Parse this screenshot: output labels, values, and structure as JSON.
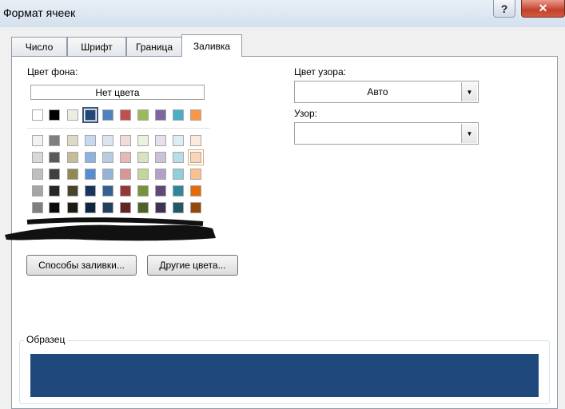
{
  "window": {
    "title": "Формат ячеек"
  },
  "titlebar": {
    "help_label": "?",
    "close_label": "✕"
  },
  "tabs": [
    {
      "label": "Число"
    },
    {
      "label": "Шрифт"
    },
    {
      "label": "Граница"
    },
    {
      "label": "Заливка"
    }
  ],
  "fill": {
    "bg_color_label": "Цвет фона:",
    "no_color_label": "Нет цвета",
    "selected_color": "#1f497d",
    "theme_row": [
      "#ffffff",
      "#000000",
      "#eeece1",
      "#1f497d",
      "#4f81bd",
      "#c0504d",
      "#9bbb59",
      "#8064a2",
      "#4bacc6",
      "#f79646"
    ],
    "shade_rows": [
      [
        "#f2f2f2",
        "#7f7f7f",
        "#ddd9c3",
        "#c6d9f0",
        "#dbe5f1",
        "#f2dcdb",
        "#ebf1dd",
        "#e5e0ec",
        "#dbeef3",
        "#fdeada"
      ],
      [
        "#d8d8d8",
        "#595959",
        "#c4bd97",
        "#8db3e2",
        "#b8cce4",
        "#e5b9b7",
        "#d7e3bc",
        "#ccc1d9",
        "#b7dde8",
        "#fbd5b5"
      ],
      [
        "#bfbfbf",
        "#3f3f3f",
        "#938953",
        "#548dd4",
        "#95b3d7",
        "#d99694",
        "#c3d69b",
        "#b2a2c7",
        "#92cddc",
        "#fac08f"
      ],
      [
        "#a5a5a5",
        "#262626",
        "#494429",
        "#17365d",
        "#366092",
        "#953734",
        "#76923c",
        "#5f497a",
        "#31859b",
        "#e36c09"
      ],
      [
        "#7f7f7f",
        "#0c0c0c",
        "#1d1b10",
        "#0f243e",
        "#244061",
        "#632423",
        "#4f6128",
        "#3f3151",
        "#205867",
        "#974806"
      ]
    ],
    "fill_effects_label": "Способы заливки...",
    "more_colors_label": "Другие цвета...",
    "pattern_color_label": "Цвет узора:",
    "pattern_color_value": "Авто",
    "pattern_style_label": "Узор:",
    "pattern_style_value": "",
    "sample_label": "Образец",
    "sample_color": "#1f497d"
  }
}
